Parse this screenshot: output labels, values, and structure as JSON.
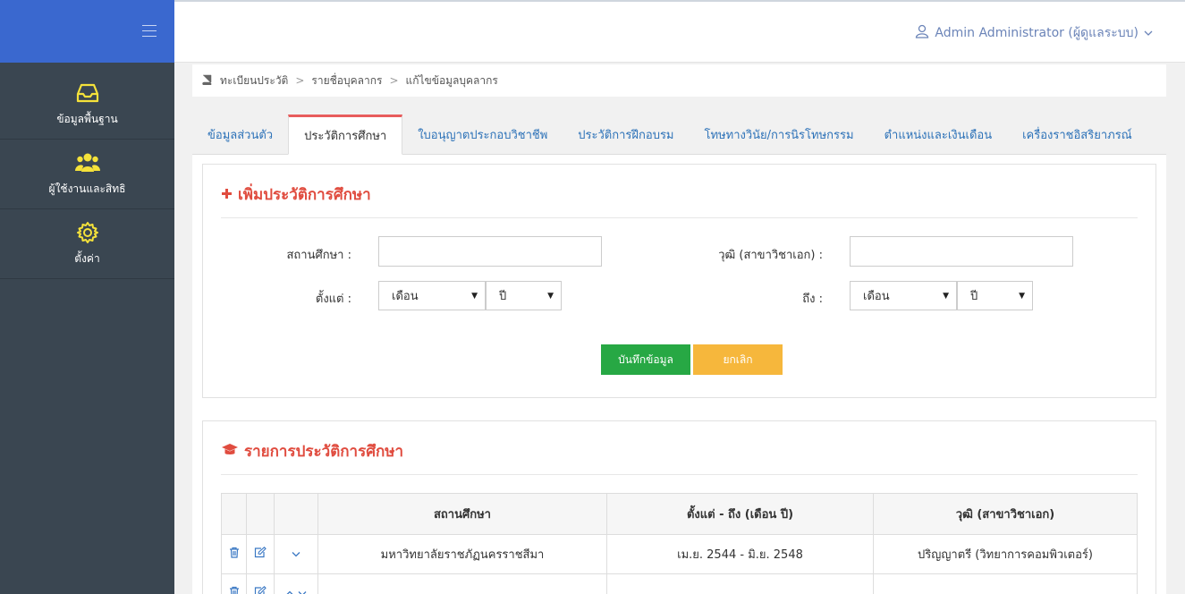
{
  "header": {
    "user_label": "Admin Administrator (ผู้ดูแลระบบ)"
  },
  "sidebar": {
    "items": [
      {
        "label": "ข้อมูลพื้นฐาน",
        "icon": "inbox-icon"
      },
      {
        "label": "ผู้ใช้งานและสิทธิ",
        "icon": "users-icon"
      },
      {
        "label": "ตั้งค่า",
        "icon": "gear-icon"
      }
    ]
  },
  "breadcrumb": {
    "items": [
      "ทะเบียนประวัติ",
      "รายชื่อบุคลากร",
      "แก้ไขข้อมูลบุคลากร"
    ]
  },
  "tabs": [
    {
      "label": "ข้อมูลส่วนตัว"
    },
    {
      "label": "ประวัติการศึกษา",
      "active": true
    },
    {
      "label": "ใบอนุญาตประกอบวิชาชีพ"
    },
    {
      "label": "ประวัติการฝึกอบรม"
    },
    {
      "label": "โทษทางวินัย/การนิรโทษกรรม"
    },
    {
      "label": "ตำแหน่งและเงินเดือน"
    },
    {
      "label": "เครื่องราชอิสริยาภรณ์"
    }
  ],
  "add_form": {
    "title": "เพิ่มประวัติการศึกษา",
    "institution_label": "สถานศึกษา :",
    "institution_value": "",
    "degree_label": "วุฒิ (สาขาวิชาเอก) :",
    "degree_value": "",
    "from_label": "ตั้งแต่ :",
    "to_label": "ถึง :",
    "month_select": "เดือน",
    "year_select": "ปี",
    "save_label": "บันทึกข้อมูล",
    "cancel_label": "ยกเลิก"
  },
  "list": {
    "title": "รายการประวัติการศึกษา",
    "columns": [
      "สถานศึกษา",
      "ตั้งแต่ - ถึง (เดือน ปี)",
      "วุฒิ (สาขาวิชาเอก)"
    ],
    "rows": [
      {
        "institution": "มหาวิทยาลัยราชภัฏนครราชสีมา",
        "period": "เม.ย. 2544 - มิ.ย. 2548",
        "degree": "ปริญญาตรี (วิทยาการคอมพิวเตอร์)"
      }
    ]
  }
}
